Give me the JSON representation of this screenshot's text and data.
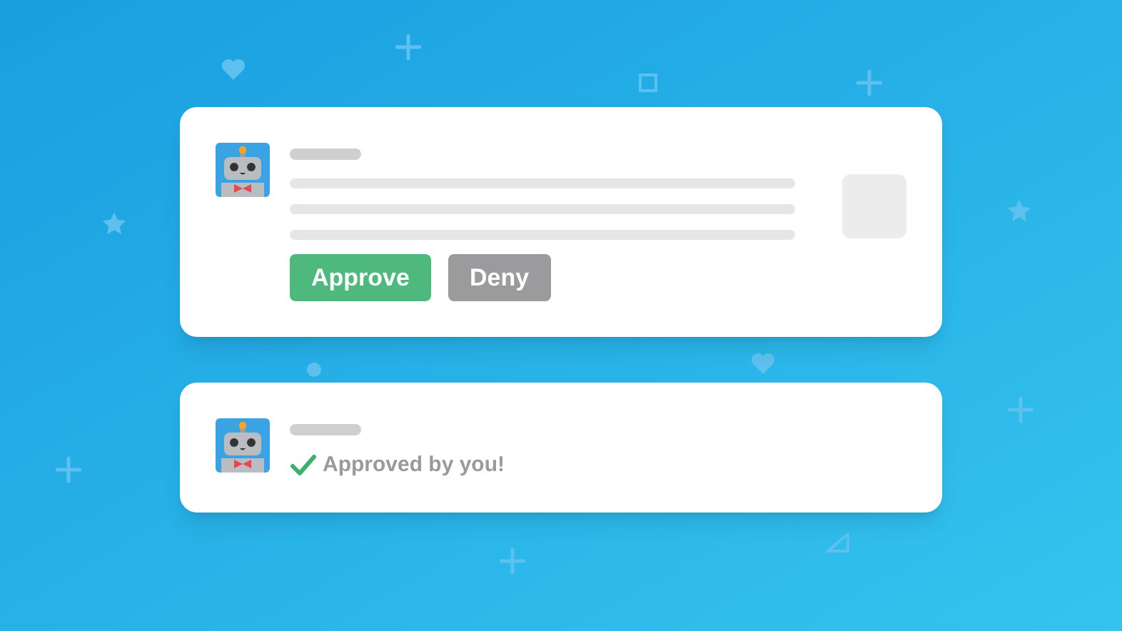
{
  "request_card": {
    "buttons": [
      {
        "label": "Approve",
        "kind": "approve"
      },
      {
        "label": "Deny",
        "kind": "deny"
      }
    ]
  },
  "result_card": {
    "status": "Approved by you!"
  }
}
